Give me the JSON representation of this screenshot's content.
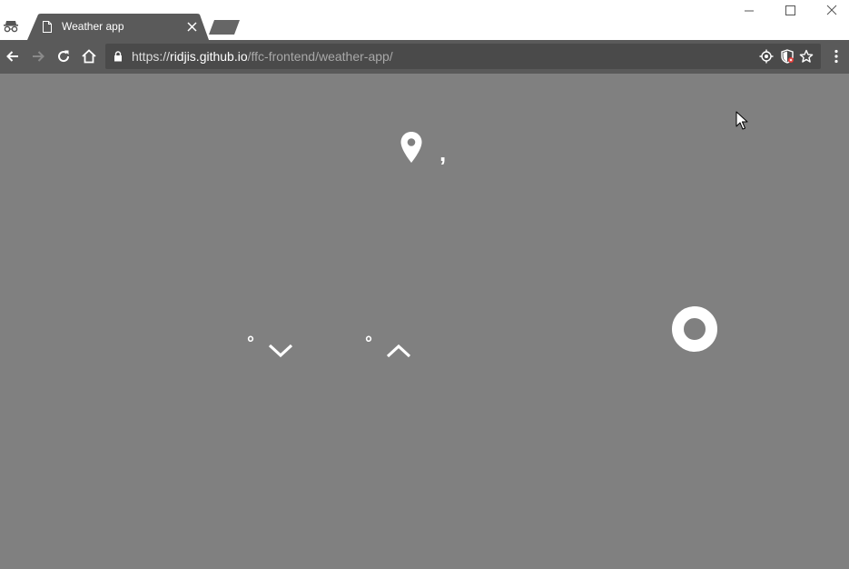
{
  "browser": {
    "tab": {
      "title": "Weather app"
    },
    "address": {
      "scheme": "https://",
      "host": "ridjis.github.io",
      "path": "/ffc-frontend/weather-app/"
    }
  },
  "page": {
    "location": ",",
    "low": {
      "value": "",
      "unit": "°"
    },
    "high": {
      "value": "",
      "unit": "°"
    }
  },
  "icons": {
    "incognito": "incognito-icon",
    "page": "page-icon",
    "location_pin": "location-pin-icon",
    "arrow_down": "chevron-down-icon",
    "arrow_up": "chevron-up-icon",
    "loading": "loading-ring-icon"
  },
  "colors": {
    "page_background": "#808080",
    "toolbar": "#5a5a5a",
    "omnibox": "#4a4a4a",
    "foreground": "#ffffff"
  }
}
